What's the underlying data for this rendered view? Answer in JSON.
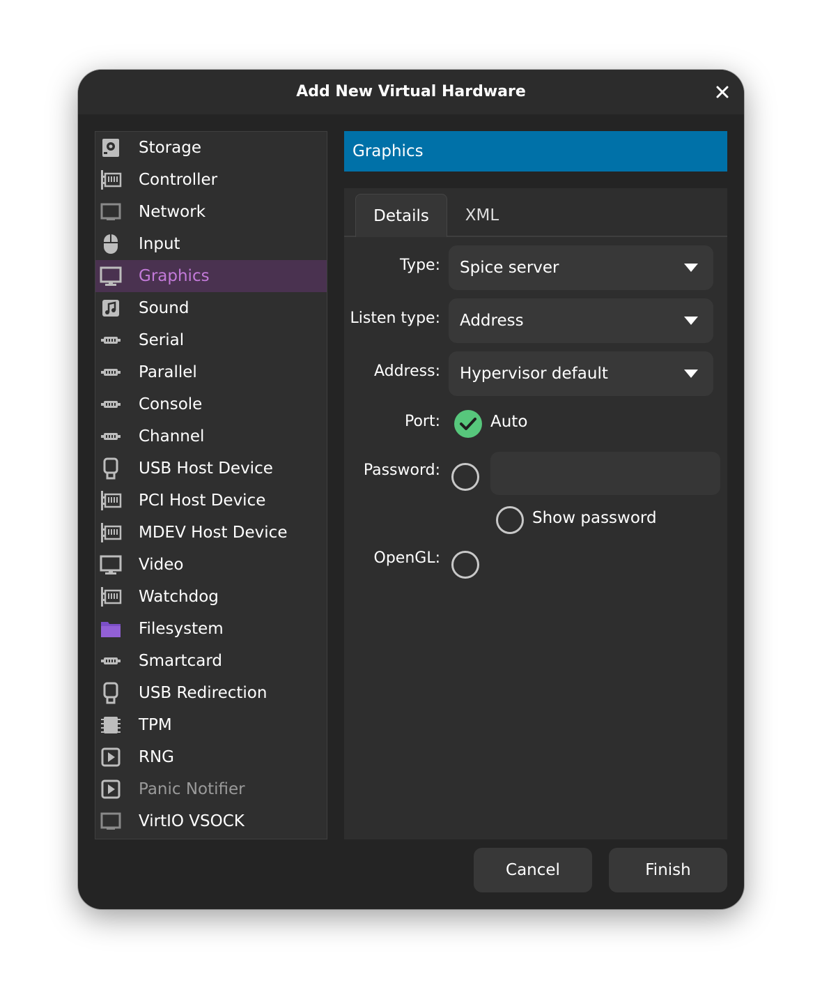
{
  "window": {
    "title": "Add New Virtual Hardware",
    "close_icon": "close-icon"
  },
  "sidebar": {
    "items": [
      {
        "label": "Storage",
        "icon": "storage-icon"
      },
      {
        "label": "Controller",
        "icon": "controller-icon"
      },
      {
        "label": "Network",
        "icon": "network-icon"
      },
      {
        "label": "Input",
        "icon": "mouse-icon"
      },
      {
        "label": "Graphics",
        "icon": "monitor-icon",
        "selected": true
      },
      {
        "label": "Sound",
        "icon": "sound-icon"
      },
      {
        "label": "Serial",
        "icon": "serial-port-icon"
      },
      {
        "label": "Parallel",
        "icon": "parallel-port-icon"
      },
      {
        "label": "Console",
        "icon": "console-port-icon"
      },
      {
        "label": "Channel",
        "icon": "channel-port-icon"
      },
      {
        "label": "USB Host Device",
        "icon": "usb-icon"
      },
      {
        "label": "PCI Host Device",
        "icon": "pci-card-icon"
      },
      {
        "label": "MDEV Host Device",
        "icon": "mdev-card-icon"
      },
      {
        "label": "Video",
        "icon": "video-monitor-icon"
      },
      {
        "label": "Watchdog",
        "icon": "watchdog-card-icon"
      },
      {
        "label": "Filesystem",
        "icon": "folder-icon"
      },
      {
        "label": "Smartcard",
        "icon": "smartcard-port-icon"
      },
      {
        "label": "USB Redirection",
        "icon": "usb-redirection-icon"
      },
      {
        "label": "TPM",
        "icon": "chip-icon"
      },
      {
        "label": "RNG",
        "icon": "rng-icon"
      },
      {
        "label": "Panic Notifier",
        "icon": "panic-notifier-icon",
        "dimmed": true
      },
      {
        "label": "VirtIO VSOCK",
        "icon": "vsock-icon"
      }
    ]
  },
  "panel": {
    "header": "Graphics",
    "tabs": [
      {
        "label": "Details",
        "active": true
      },
      {
        "label": "XML",
        "active": false
      }
    ],
    "fields": {
      "type": {
        "label": "Type:",
        "value": "Spice server"
      },
      "listen_type": {
        "label": "Listen type:",
        "value": "Address"
      },
      "address": {
        "label": "Address:",
        "value": "Hypervisor default"
      },
      "port": {
        "label": "Port:",
        "checkbox_label": "Auto",
        "checked": true
      },
      "password": {
        "label": "Password:",
        "checked": false,
        "value": ""
      },
      "show_password": {
        "label": "Show password",
        "checked": false
      },
      "opengl": {
        "label": "OpenGL:",
        "checked": false
      }
    }
  },
  "footer": {
    "cancel_label": "Cancel",
    "finish_label": "Finish"
  },
  "colors": {
    "background": "#242424",
    "selection": "#4a3250",
    "selection_text": "#c37ad9",
    "header_blue": "#0071a8",
    "check_green": "#57c77c"
  }
}
